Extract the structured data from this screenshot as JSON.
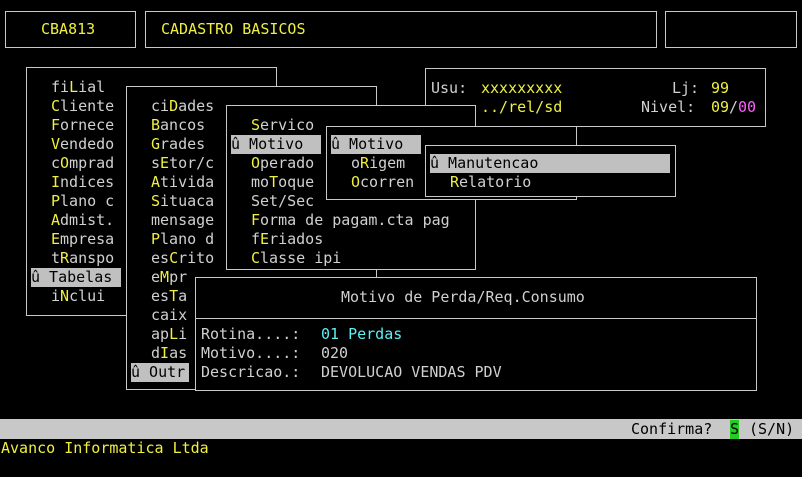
{
  "header": {
    "program_code": "CBA813",
    "screen_title": "CADASTRO BASICOS"
  },
  "session": {
    "user_label": "Usu:",
    "user_value": "xxxxxxxxx",
    "store_label": "Lj:",
    "store_value": "99",
    "path": "../rel/sd",
    "level_label": "Nivel:",
    "level_value": "09",
    "level_sep": "/",
    "level_max": "00"
  },
  "menu1": {
    "items": [
      {
        "hot": "",
        "pre": "fi",
        "key": "L",
        "post": "ial"
      },
      {
        "pre": "",
        "key": "C",
        "post": "liente"
      },
      {
        "pre": "",
        "key": "F",
        "post": "ornece"
      },
      {
        "pre": "",
        "key": "V",
        "post": "endedo"
      },
      {
        "pre": "c",
        "key": "O",
        "post": "mprad"
      },
      {
        "pre": "",
        "key": "I",
        "post": "ndices"
      },
      {
        "pre": "",
        "key": "P",
        "post": "lano c"
      },
      {
        "pre": "",
        "key": "A",
        "post": "dmist."
      },
      {
        "pre": "",
        "key": "E",
        "post": "mpresa"
      },
      {
        "pre": "t",
        "key": "R",
        "post": "anspo"
      },
      {
        "selected": "û Tabelas"
      },
      {
        "pre": "i",
        "key": "N",
        "post": "clui"
      }
    ]
  },
  "menu2": {
    "items": [
      {
        "pre": "ci",
        "key": "D",
        "post": "ades"
      },
      {
        "pre": "",
        "key": "B",
        "post": "ancos"
      },
      {
        "pre": "",
        "key": "G",
        "post": "rades"
      },
      {
        "pre": "s",
        "key": "E",
        "post": "tor/c"
      },
      {
        "pre": "",
        "key": "A",
        "post": "tivida"
      },
      {
        "pre": "",
        "key": "S",
        "post": "ituaca"
      },
      {
        "pre": "",
        "key": "",
        "post": "mensage"
      },
      {
        "pre": "",
        "key": "P",
        "post": "lano d"
      },
      {
        "pre": "es",
        "key": "C",
        "post": "rito"
      },
      {
        "pre": "e",
        "key": "M",
        "post": "pr"
      },
      {
        "pre": "es",
        "key": "T",
        "post": "a"
      },
      {
        "pre": "",
        "key": "",
        "post": "caix"
      },
      {
        "pre": "ap",
        "key": "L",
        "post": "i"
      },
      {
        "pre": "d",
        "key": "I",
        "post": "as"
      },
      {
        "selected": "û Outr"
      }
    ]
  },
  "menu3": {
    "items": [
      {
        "pre": "",
        "key": "S",
        "post": "ervico"
      },
      {
        "selected": "û Motivo"
      },
      {
        "pre": "",
        "key": "O",
        "post": "perado"
      },
      {
        "pre": "mo",
        "key": "T",
        "post": "oque"
      },
      {
        "pre": "Set/Sec",
        "key": "",
        "post": ""
      },
      {
        "pre": "",
        "key": "F",
        "post": "orma de pagam.cta pag"
      },
      {
        "pre": "f",
        "key": "E",
        "post": "riados"
      },
      {
        "pre": "",
        "key": "C",
        "post": "lasse ipi"
      }
    ]
  },
  "menu4": {
    "items": [
      {
        "selected": "û Motivo"
      },
      {
        "pre": "o",
        "key": "R",
        "post": "igem"
      },
      {
        "pre": "",
        "key": "O",
        "post": "corren"
      }
    ]
  },
  "menu5": {
    "items": [
      {
        "selected": "û Manutencao"
      },
      {
        "pre": "",
        "key": "R",
        "post": "elatorio"
      }
    ]
  },
  "dialog": {
    "title": "Motivo de Perda/Req.Consumo",
    "rotina_label": "Rotina....:",
    "rotina_value": "01 Perdas",
    "motivo_label": "Motivo....:",
    "motivo_value": "020",
    "descricao_label": "Descricao.:",
    "descricao_value": "DEVOLUCAO VENDAS PDV"
  },
  "status_bar": {
    "prompt": "Confirma?",
    "answer": "S",
    "options": "(S/N)"
  },
  "footer": {
    "company": "Avanco Informatica Ltda"
  },
  "colors": {
    "background": "#000000",
    "hotkey": "#f0f040",
    "text": "#d0d0d0",
    "value": "#5ff0f0",
    "highlight": "#c0c0c0",
    "answer_bg": "#22cc22",
    "level_max": "#ff60ff"
  }
}
